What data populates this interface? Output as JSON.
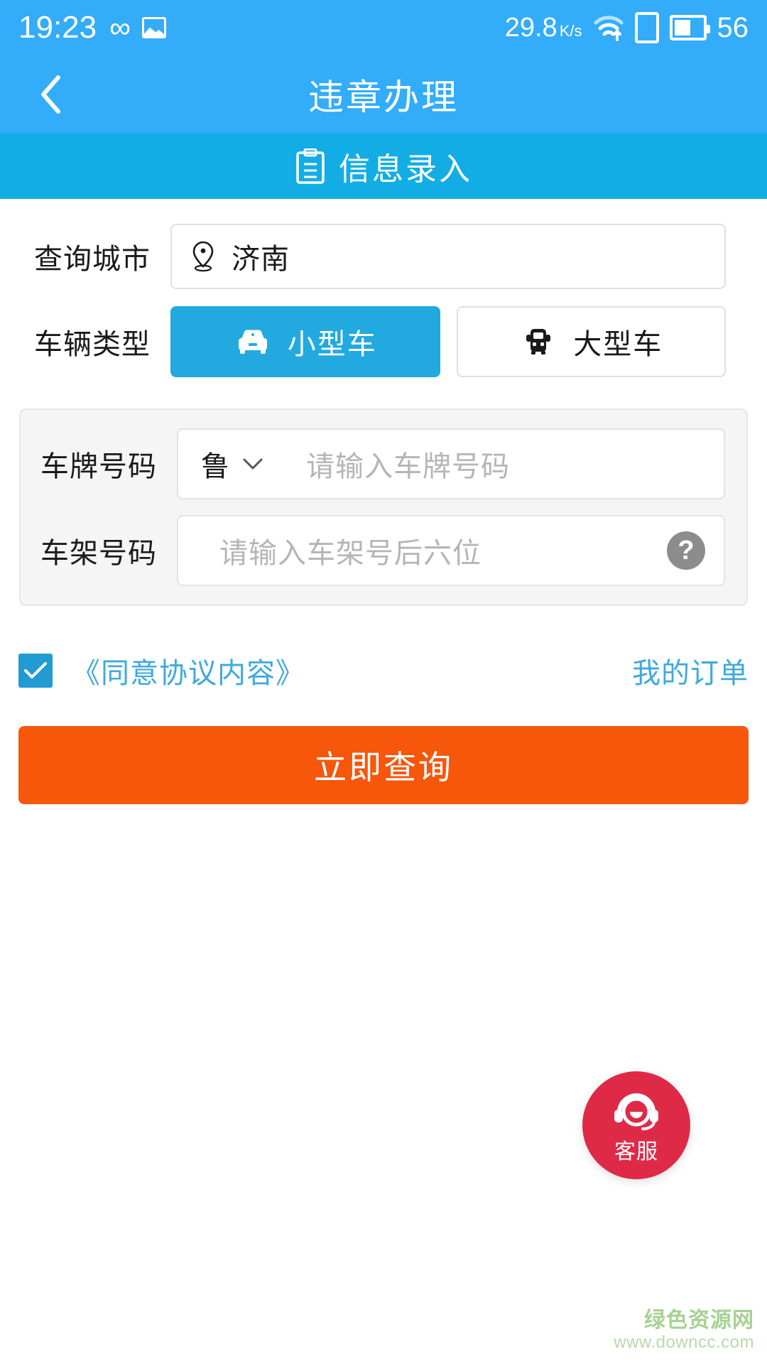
{
  "status_bar": {
    "time": "19:23",
    "infinity_icon": "infinity-icon",
    "gallery_icon": "image-icon",
    "net_speed": "29.8",
    "net_speed_unit": "K/s",
    "wifi_icon": "wifi-icon",
    "sim_icon": "sim-card-icon",
    "battery_icon": "battery-icon",
    "battery_percent": "56"
  },
  "header": {
    "back_icon": "back-chevron-icon",
    "title": "违章办理"
  },
  "sub_header": {
    "icon": "clipboard-icon",
    "label": "信息录入"
  },
  "form": {
    "city": {
      "label": "查询城市",
      "icon": "location-pin-icon",
      "value": "济南"
    },
    "vehicle_type": {
      "label": "车辆类型",
      "options": [
        {
          "label": "小型车",
          "icon": "car-icon",
          "selected": true
        },
        {
          "label": "大型车",
          "icon": "bus-icon",
          "selected": false
        }
      ]
    },
    "plate": {
      "label": "车牌号码",
      "province": "鲁",
      "dropdown_icon": "chevron-down-icon",
      "placeholder": "请输入车牌号码",
      "value": ""
    },
    "vin": {
      "label": "车架号码",
      "placeholder": "请输入车架号后六位",
      "value": "",
      "help_icon": "question-mark-icon",
      "help_glyph": "?"
    }
  },
  "agreement": {
    "checked": true,
    "check_icon": "checkmark-icon",
    "label": "《同意协议内容》",
    "my_orders": "我的订单"
  },
  "submit": {
    "label": "立即查询"
  },
  "customer_service": {
    "icon": "headset-support-icon",
    "label": "客服"
  },
  "watermark": {
    "site_name": "绿色资源网",
    "url": "www.downcc.com"
  },
  "colors": {
    "status_bar_blue": "#33ACFA",
    "sub_header_blue": "#13ADE6",
    "selected_blue": "#22A9E0",
    "link_blue": "#3FA9DC",
    "checkbox_blue": "#229BD4",
    "submit_orange": "#F6570B",
    "cs_red": "#DF2A47",
    "panel_gray": "#f5f5f5",
    "placeholder_gray": "#b5b5b5",
    "watermark_green": "#A7D192"
  }
}
